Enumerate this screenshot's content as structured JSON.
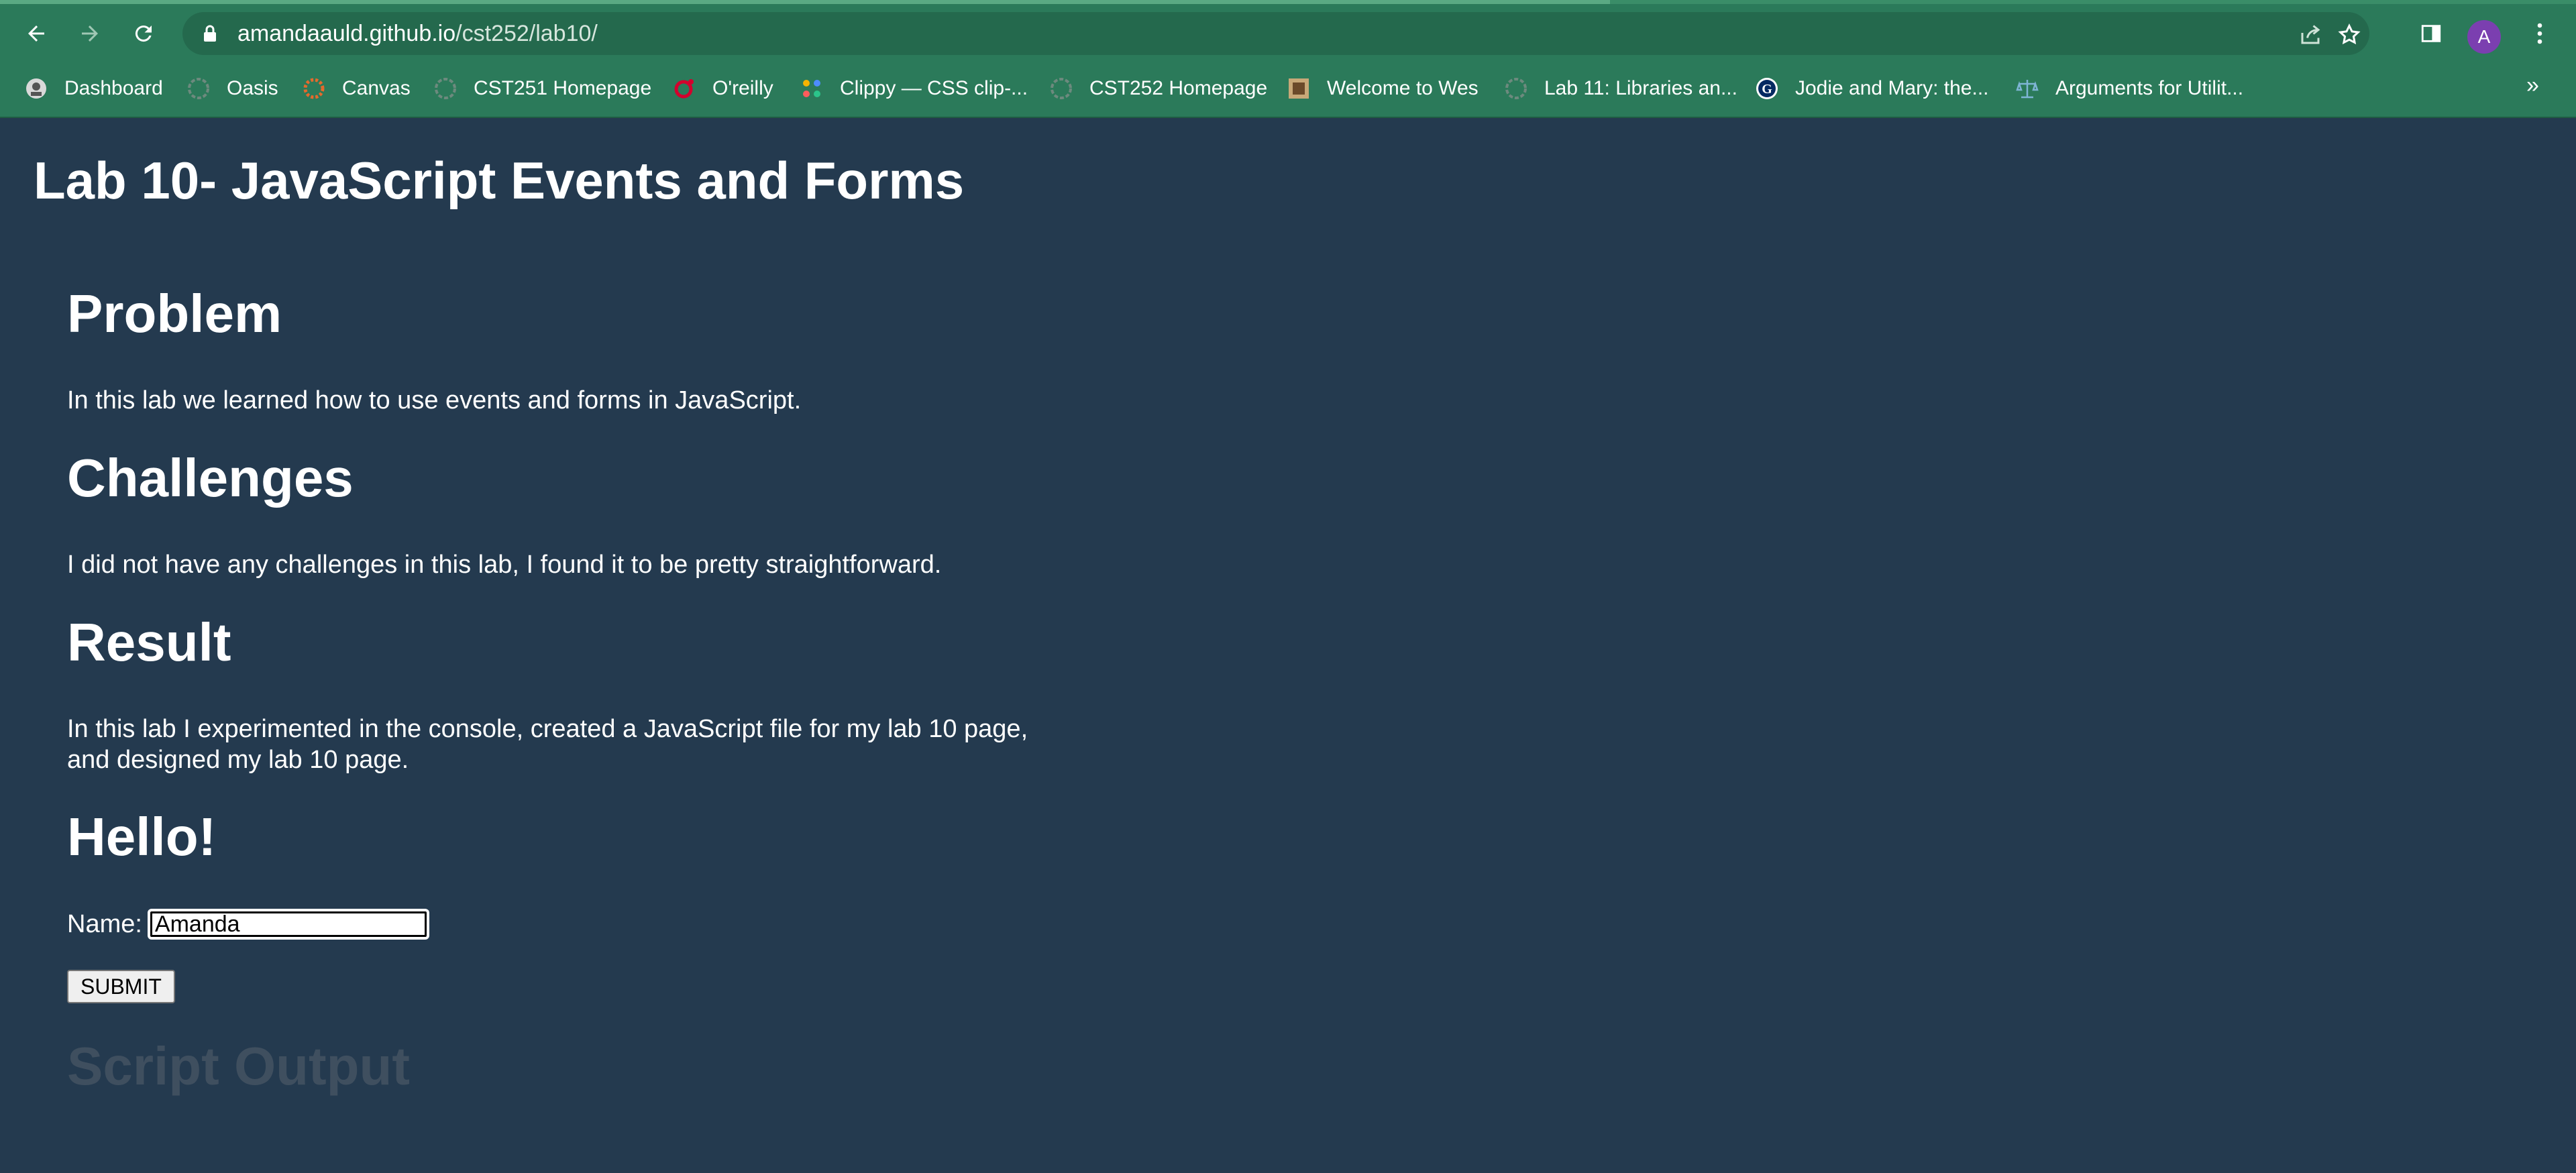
{
  "browser": {
    "url_host": "amandaauld.github.io",
    "url_path": "/cst252/lab10/",
    "avatar_letter": "A",
    "bookmarks_overflow": "»",
    "bookmarks": [
      {
        "label": "Dashboard",
        "icon": "dashboard-favicon"
      },
      {
        "label": "Oasis",
        "icon": "oasis-favicon"
      },
      {
        "label": "Canvas",
        "icon": "canvas-favicon"
      },
      {
        "label": "CST251 Homepage",
        "icon": "cst251-favicon"
      },
      {
        "label": "O'reilly",
        "icon": "oreilly-favicon"
      },
      {
        "label": "Clippy — CSS clip-...",
        "icon": "clippy-favicon"
      },
      {
        "label": "CST252 Homepage",
        "icon": "cst252-favicon"
      },
      {
        "label": "Welcome to Wes",
        "icon": "wes-favicon"
      },
      {
        "label": "Lab 11: Libraries an...",
        "icon": "lab11-favicon"
      },
      {
        "label": "Jodie and Mary: the...",
        "icon": "guardian-favicon"
      },
      {
        "label": "Arguments for Utilit...",
        "icon": "scales-favicon"
      }
    ]
  },
  "page": {
    "title": "Lab 10- JavaScript Events and Forms",
    "problem_heading": "Problem",
    "problem_text": "In this lab we learned how to use events and forms in JavaScript.",
    "challenges_heading": "Challenges",
    "challenges_text": "I did not have any challenges in this lab, I found it to be pretty straightforward.",
    "result_heading": "Result",
    "result_text": "In this lab I experimented in the console, created a JavaScript file for my lab 10 page, and designed my lab 10 page.",
    "hello_heading": "Hello!",
    "name_label": "Name:",
    "name_value": "Amanda",
    "submit_label": "SUBMIT",
    "output_heading": "Script Output"
  },
  "colors": {
    "page_background": "#243a4f",
    "chrome_background": "#2b7a5a",
    "avatar": "#7b3fb0"
  }
}
